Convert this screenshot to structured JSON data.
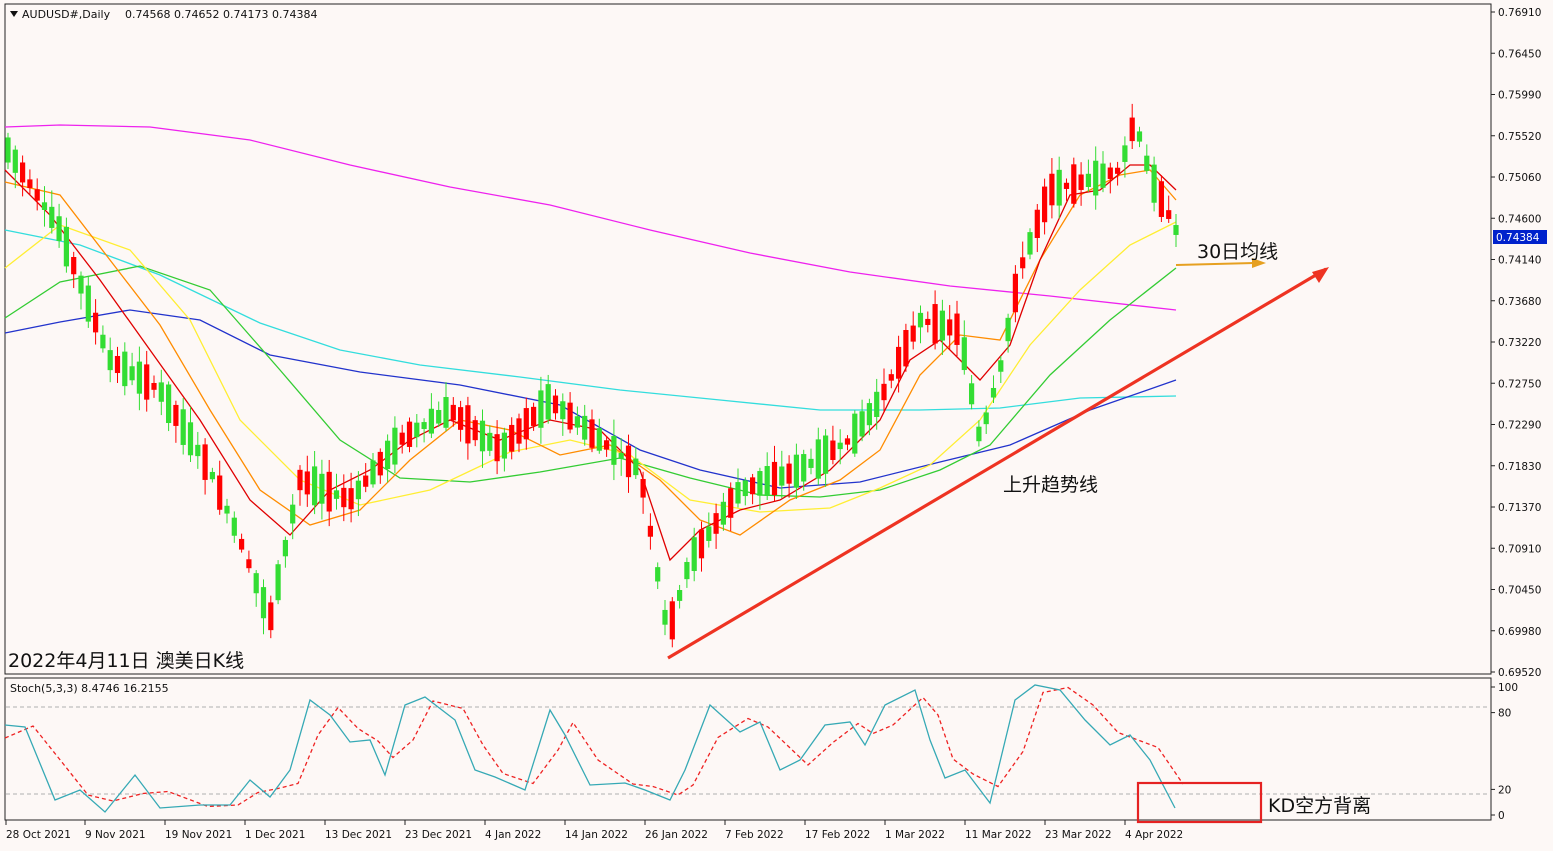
{
  "chart_data": [
    {
      "type": "candlestick",
      "symbol_header": "AUDUSD#,Daily",
      "ohlc_header": "0.74568 0.74652 0.74173 0.74384",
      "current_price": "0.74384",
      "ylim": [
        0.6952,
        0.7691
      ],
      "y_ticks": [
        "0.76910",
        "0.76450",
        "0.75990",
        "0.75520",
        "0.75060",
        "0.74600",
        "0.74140",
        "0.73680",
        "0.73220",
        "0.72750",
        "0.72290",
        "0.71830",
        "0.71370",
        "0.70910",
        "0.70450",
        "0.69980",
        "0.69520"
      ],
      "x_ticks": [
        "28 Oct 2021",
        "9 Nov 2021",
        "19 Nov 2021",
        "1 Dec 2021",
        "13 Dec 2021",
        "23 Dec 2021",
        "4 Jan 2022",
        "14 Jan 2022",
        "26 Jan 2022",
        "7 Feb 2022",
        "17 Feb 2022",
        "1 Mar 2022",
        "11 Mar 2022",
        "23 Mar 2022",
        "4 Apr 2022"
      ],
      "annotations": {
        "ma30_label": "30日均线",
        "trendline_label": "上升趋势线",
        "chart_caption": "2022年4月11日 澳美日K线"
      },
      "colors": {
        "up": "#ff0000",
        "down": "#33dd33",
        "ma5": "#e00000",
        "ma10": "#ff8c00",
        "ma20": "#ffee33",
        "ma30": "#33cc33",
        "ma60": "#2233cc",
        "ma120": "#33dddd",
        "ma240": "#ee22ee",
        "trendline": "#ee3322",
        "arrow": "#e6a020",
        "current_price_bg": "#0022cc"
      }
    },
    {
      "type": "line",
      "indicator_header": "Stoch(5,3,3) 8.4746 16.2155",
      "ylim": [
        0,
        100
      ],
      "y_ticks": [
        "100",
        "80",
        "20",
        "0"
      ],
      "levels": [
        80,
        20
      ],
      "series": [
        {
          "name": "%K",
          "color": "#36a9b5",
          "style": "solid"
        },
        {
          "name": "%D",
          "color": "#ee2222",
          "style": "dashed"
        }
      ],
      "annotations": {
        "box_label": "KD空方背离"
      }
    }
  ]
}
